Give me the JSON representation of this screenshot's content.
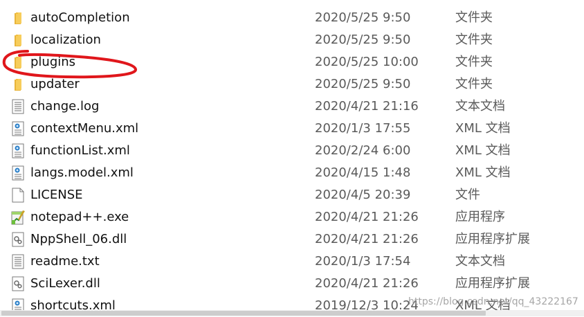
{
  "files": [
    {
      "name": "autoCompletion",
      "date": "2020/5/25 9:50",
      "type": "文件夹",
      "icon": "folder-icon"
    },
    {
      "name": "localization",
      "date": "2020/5/25 9:50",
      "type": "文件夹",
      "icon": "folder-icon"
    },
    {
      "name": "plugins",
      "date": "2020/5/25 10:00",
      "type": "文件夹",
      "icon": "folder-icon"
    },
    {
      "name": "updater",
      "date": "2020/5/25 9:50",
      "type": "文件夹",
      "icon": "folder-icon"
    },
    {
      "name": "change.log",
      "date": "2020/4/21 21:16",
      "type": "文本文档",
      "icon": "text-file-icon"
    },
    {
      "name": "contextMenu.xml",
      "date": "2020/1/3 17:55",
      "type": "XML 文档",
      "icon": "xml-file-icon"
    },
    {
      "name": "functionList.xml",
      "date": "2020/2/24 6:00",
      "type": "XML 文档",
      "icon": "xml-file-icon"
    },
    {
      "name": "langs.model.xml",
      "date": "2020/4/15 1:48",
      "type": "XML 文档",
      "icon": "xml-file-icon"
    },
    {
      "name": "LICENSE",
      "date": "2020/4/5 20:39",
      "type": "文件",
      "icon": "blank-file-icon"
    },
    {
      "name": "notepad++.exe",
      "date": "2020/4/21 21:26",
      "type": "应用程序",
      "icon": "exe-file-icon"
    },
    {
      "name": "NppShell_06.dll",
      "date": "2020/4/21 21:26",
      "type": "应用程序扩展",
      "icon": "dll-file-icon"
    },
    {
      "name": "readme.txt",
      "date": "2020/1/3 17:54",
      "type": "文本文档",
      "icon": "text-file-icon"
    },
    {
      "name": "SciLexer.dll",
      "date": "2020/4/21 21:26",
      "type": "应用程序扩展",
      "icon": "dll-file-icon"
    },
    {
      "name": "shortcuts.xml",
      "date": "2019/12/3 10:24",
      "type": "XML 文档",
      "icon": "xml-file-icon"
    }
  ],
  "watermark": "https://blog.csdn.net/qq_43222167",
  "colors": {
    "folder": "#f5c542",
    "annotation": "#e0161b",
    "date_text": "#5a5a5a"
  }
}
